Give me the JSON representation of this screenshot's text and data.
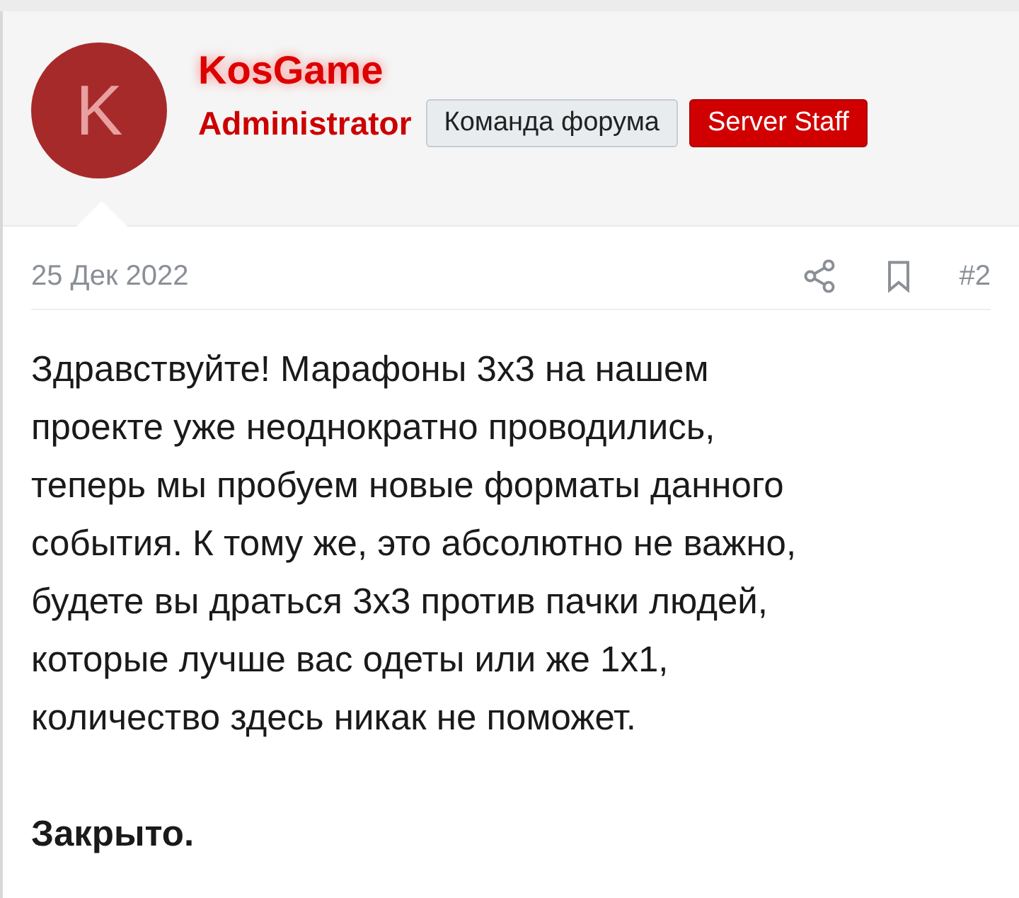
{
  "author": {
    "avatar_letter": "K",
    "name": "KosGame",
    "title": "Administrator",
    "banners": [
      {
        "label": "Команда форума",
        "kind": "plain"
      },
      {
        "label": "Server Staff",
        "kind": "red"
      }
    ]
  },
  "post": {
    "date": "25 Дек 2022",
    "number": "#2",
    "lines": [
      "Здравствуйте! Марафоны 3х3 на нашем",
      "проекте уже неоднократно проводились,",
      "теперь мы пробуем новые форматы данного",
      "события. К тому же, это абсолютно не важно,",
      "будете вы драться 3х3 против пачки людей,",
      "которые лучше вас одеты или же 1х1,",
      "количество здесь никак не поможет."
    ],
    "closing": "Закрыто."
  }
}
